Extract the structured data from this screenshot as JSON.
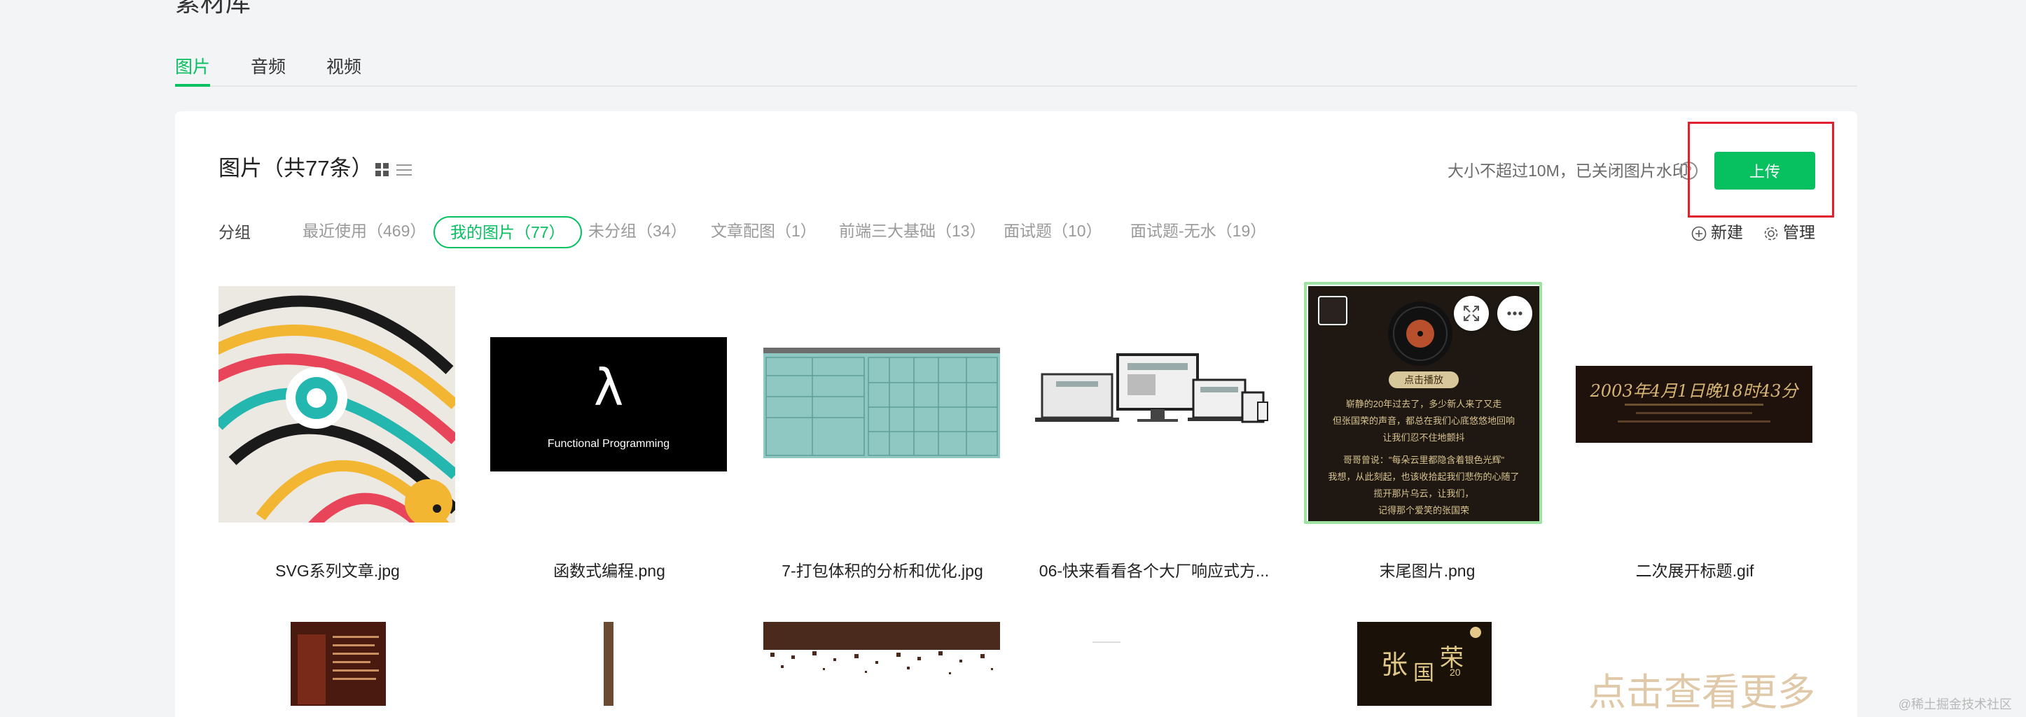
{
  "page": {
    "title": "素材库"
  },
  "tabs": [
    {
      "label": "图片",
      "active": true
    },
    {
      "label": "音频",
      "active": false
    },
    {
      "label": "视频",
      "active": false
    }
  ],
  "library": {
    "title": "图片（共77条）",
    "limit_note": "大小不超过10M，已关闭图片水印",
    "help_icon": "?",
    "upload_label": "上传",
    "group_label": "分组",
    "groups": [
      {
        "label": "最近使用（469）",
        "active": false
      },
      {
        "label": "我的图片（77）",
        "active": true
      },
      {
        "label": "未分组（34）",
        "active": false
      },
      {
        "label": "文章配图（1）",
        "active": false
      },
      {
        "label": "前端三大基础（13）",
        "active": false
      },
      {
        "label": "面试题（10）",
        "active": false
      },
      {
        "label": "面试题-无水（19）",
        "active": false
      }
    ],
    "new_group_label": "新建",
    "manage_label": "管理"
  },
  "images": [
    {
      "name": "SVG系列文章.jpg"
    },
    {
      "name": "函数式编程.png",
      "thumb_text": "λ",
      "thumb_caption": "Functional Programming"
    },
    {
      "name": "7-打包体积的分析和优化.jpg"
    },
    {
      "name": "06-快来看看各个大厂响应式方..."
    },
    {
      "name": "末尾图片.png",
      "selected": true,
      "thumb_badge": "点击播放",
      "thumb_lines": [
        "崭静的20年过去了，多少新人来了又走",
        "但张国荣的声音，都总在我们心底悠悠地回响",
        "让我们忍不住地颤抖",
        "哥哥曾说：\"每朵云里都隐含着银色光辉\"",
        "我想，从此刻起，也该收拾起我们悲伤的心随了",
        "揽开那片乌云，让我们，",
        "记得那个爱笑的张国荣"
      ]
    },
    {
      "name": "二次展开标题.gif",
      "thumb_text": "2003年4月1日晚18时43分"
    }
  ],
  "second_row": {
    "more_text": "点击查看更多",
    "poster_names": [
      "张",
      "国",
      "荣"
    ],
    "poster_badge": "20"
  },
  "watermark": "@稀土掘金技术社区",
  "colors": {
    "accent": "#07c160",
    "highlight": "#e0202e"
  }
}
